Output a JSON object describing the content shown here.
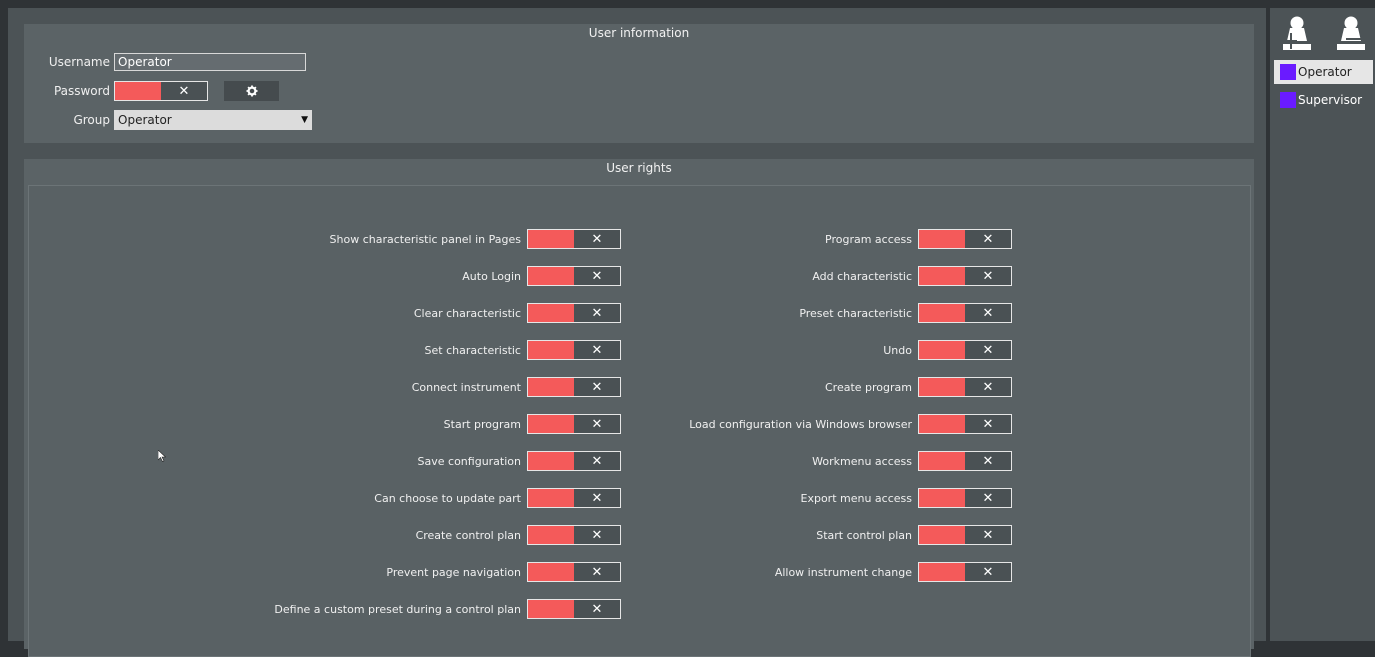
{
  "user_info": {
    "title": "User information",
    "username_label": "Username",
    "username_value": "Operator",
    "password_label": "Password",
    "group_label": "Group",
    "group_value": "Operator",
    "toggle_symbol": "✕"
  },
  "user_rights": {
    "title": "User rights",
    "left": [
      "Show characteristic panel in Pages",
      "Auto Login",
      "Clear characteristic",
      "Set characteristic",
      "Connect instrument",
      "Start program",
      "Save configuration",
      "Can choose to update part",
      "Create control plan",
      "Prevent page navigation",
      "Define a custom preset during a control plan"
    ],
    "right": [
      "Program access",
      "Add characteristic",
      "Preset characteristic",
      "Undo",
      "Create program",
      "Load configuration via Windows browser",
      "Workmenu access",
      "Export menu access",
      "Start control plan",
      "Allow instrument change"
    ]
  },
  "sidebar": {
    "users": [
      {
        "name": "Operator",
        "selected": true
      },
      {
        "name": "Supervisor",
        "selected": false
      }
    ]
  },
  "colors": {
    "toggle_on": "#f45a5a",
    "user_swatch": "#6a1bff"
  }
}
